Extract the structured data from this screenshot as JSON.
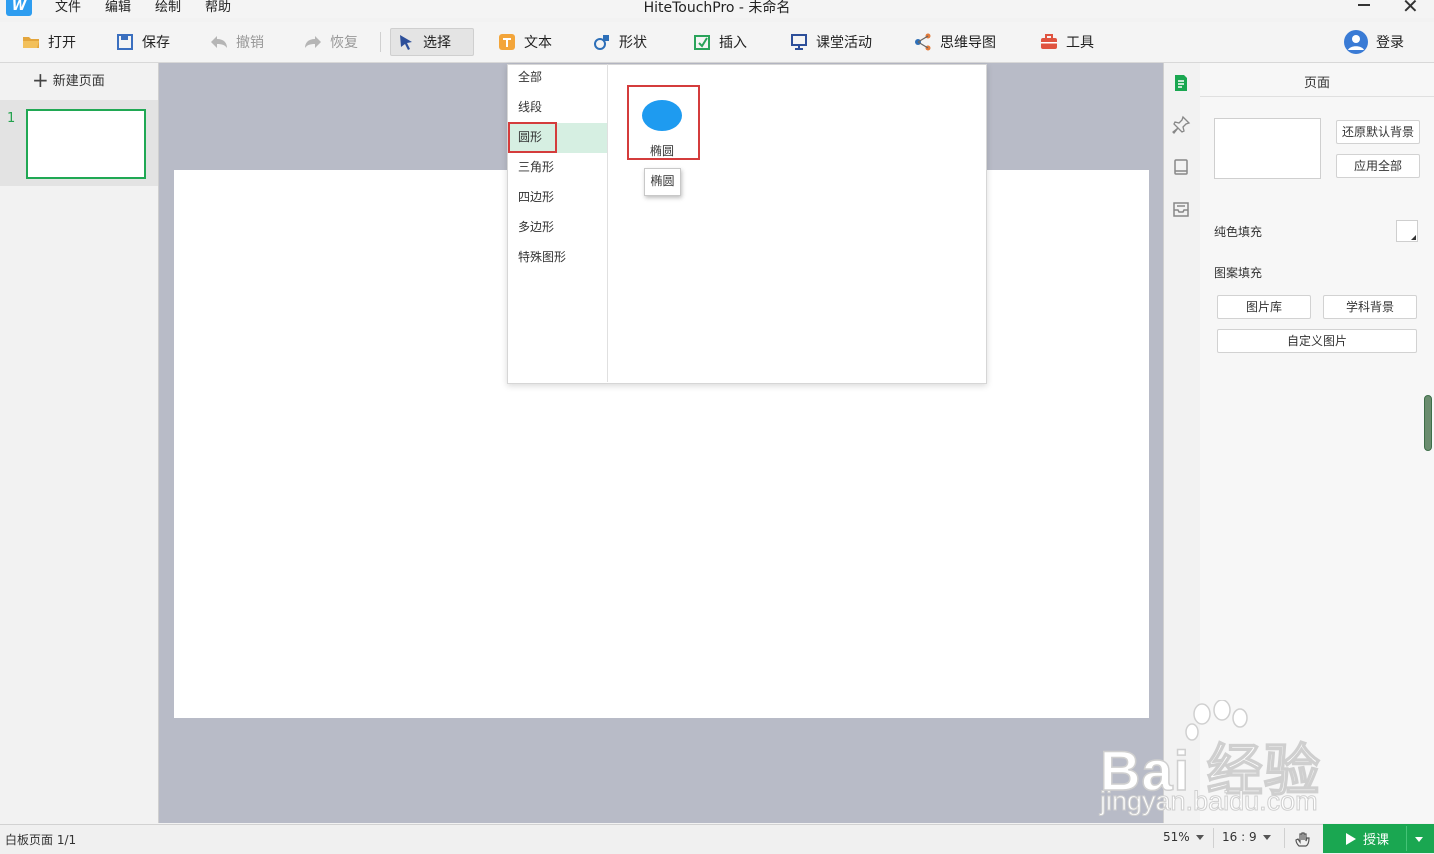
{
  "app": {
    "title": "HiteTouchPro - 未命名",
    "logo_glyph": "W"
  },
  "menu": [
    "文件",
    "编辑",
    "绘制",
    "帮助"
  ],
  "toolbar": {
    "open": "打开",
    "save": "保存",
    "undo": "撤销",
    "redo": "恢复",
    "select": "选择",
    "text": "文本",
    "shape": "形状",
    "insert": "插入",
    "class_activity": "课堂活动",
    "mind_map": "思维导图",
    "tools": "工具",
    "login": "登录"
  },
  "left_panel": {
    "new_page": "新建页面",
    "pages": [
      {
        "number": "1"
      }
    ]
  },
  "shape_popup": {
    "categories": [
      "全部",
      "线段",
      "圆形",
      "三角形",
      "四边形",
      "多边形",
      "特殊图形"
    ],
    "selected_category": "圆形",
    "items": [
      {
        "label": "椭圆",
        "icon": "ellipse-shape",
        "color": "#1e9bf0"
      }
    ],
    "tooltip": "椭圆"
  },
  "right_panel": {
    "title": "页面",
    "restore_bg": "还原默认背景",
    "apply_all": "应用全部",
    "solid_fill": "纯色填充",
    "pattern_fill": "图案填充",
    "gallery": "图片库",
    "subject_bg": "学科背景",
    "custom_image": "自定义图片",
    "side_icons": [
      "page-icon",
      "pin-icon",
      "layers-icon",
      "inbox-icon"
    ]
  },
  "statusbar": {
    "page_info": "白板页面 1/1",
    "zoom": "51%",
    "ratio": "16 : 9",
    "teach": "授课"
  },
  "watermark": {
    "brand": "Bai 经验",
    "sub": "jingyan.baidu.com"
  },
  "colors": {
    "accent_green": "#1aa751",
    "highlight_red": "#d43c3c",
    "canvas_gray": "#b8bbc7"
  }
}
